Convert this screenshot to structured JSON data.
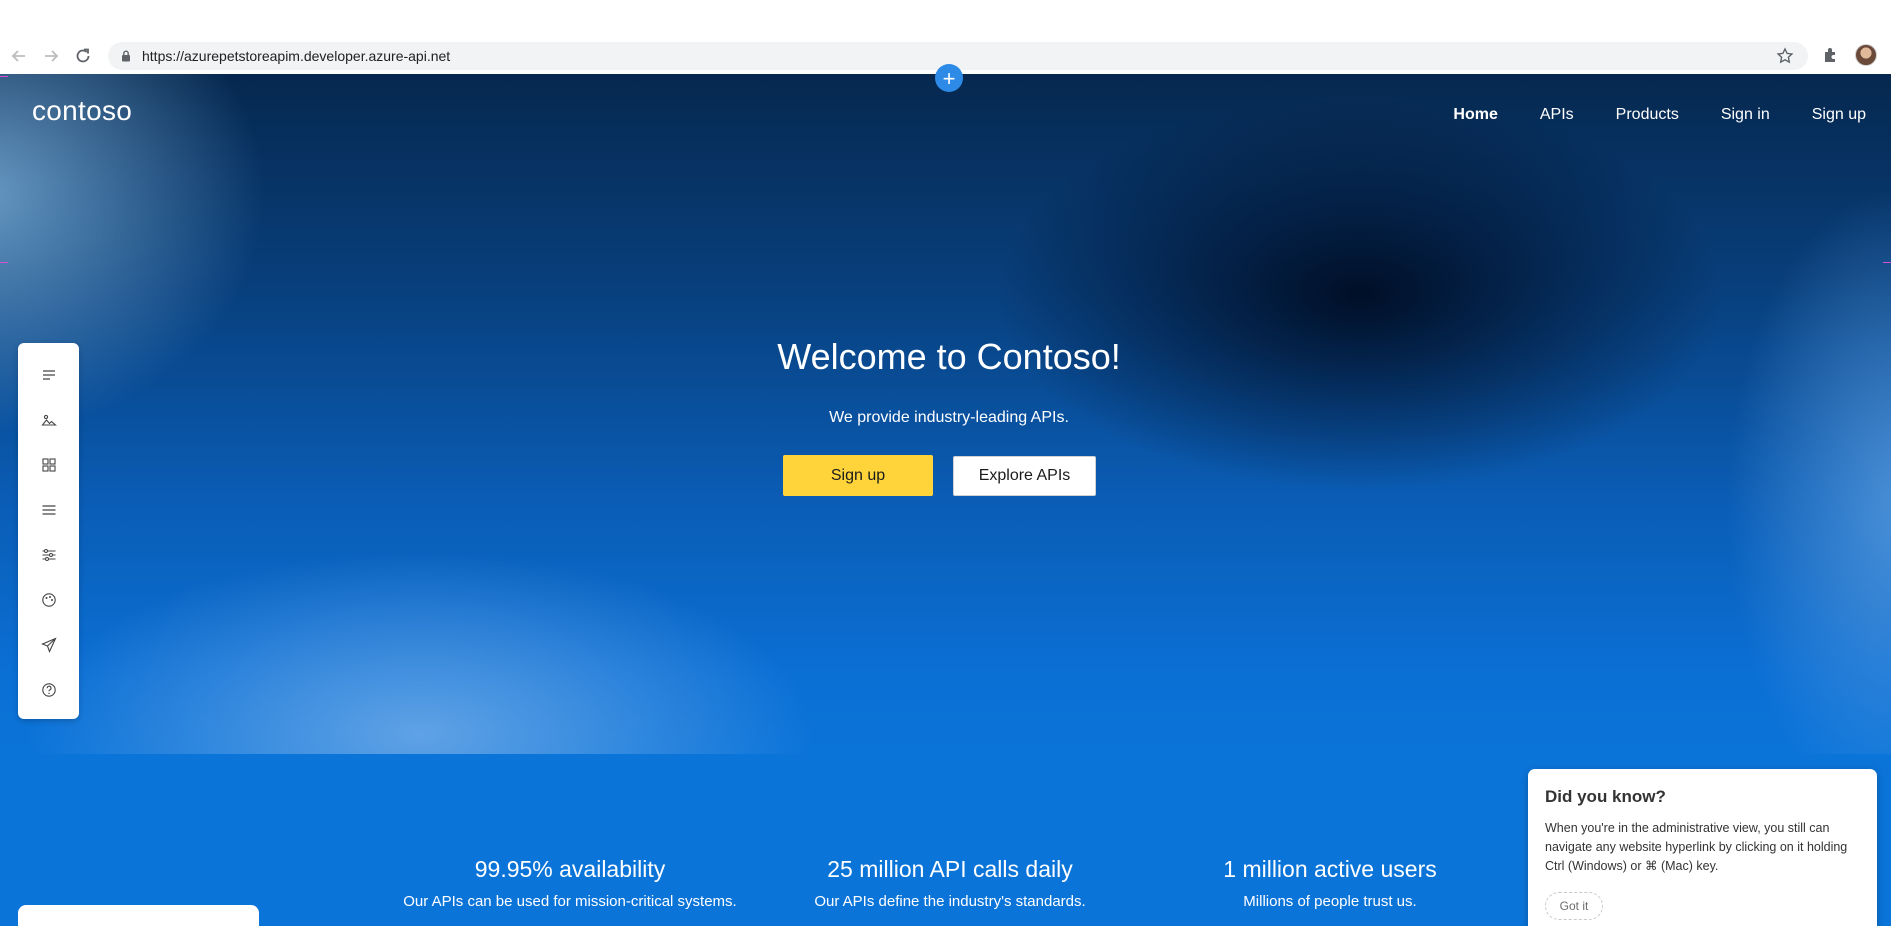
{
  "browser": {
    "url": "https://azurepetstoreapim.developer.azure-api.net"
  },
  "site": {
    "logo": "contoso",
    "nav": [
      {
        "label": "Home",
        "active": true
      },
      {
        "label": "APIs",
        "active": false
      },
      {
        "label": "Products",
        "active": false
      },
      {
        "label": "Sign in",
        "active": false
      },
      {
        "label": "Sign up",
        "active": false
      }
    ]
  },
  "hero": {
    "title": "Welcome to Contoso!",
    "subtitle": "We provide industry-leading APIs.",
    "primary_button": "Sign up",
    "secondary_button": "Explore APIs"
  },
  "editor_toolbar": {
    "icons": [
      "pages-icon",
      "media-icon",
      "layouts-icon",
      "navigation-icon",
      "settings-icon",
      "styles-icon",
      "publish-icon",
      "help-icon"
    ]
  },
  "stats": [
    {
      "title": "99.95% availability",
      "description": "Our APIs can be used for mission-critical systems."
    },
    {
      "title": "25 million API calls daily",
      "description": "Our APIs define the industry's standards."
    },
    {
      "title": "1 million active users",
      "description": "Millions of people trust us."
    }
  ],
  "tip": {
    "title": "Did you know?",
    "body": "When you're in the administrative view, you still can navigate any website hyperlink by clicking on it holding Ctrl (Windows) or ⌘ (Mac) key.",
    "button": "Got it"
  },
  "colors": {
    "accent_yellow": "#ffd43b",
    "brand_blue": "#0b74d9",
    "add_button_blue": "#2d8ae6"
  }
}
